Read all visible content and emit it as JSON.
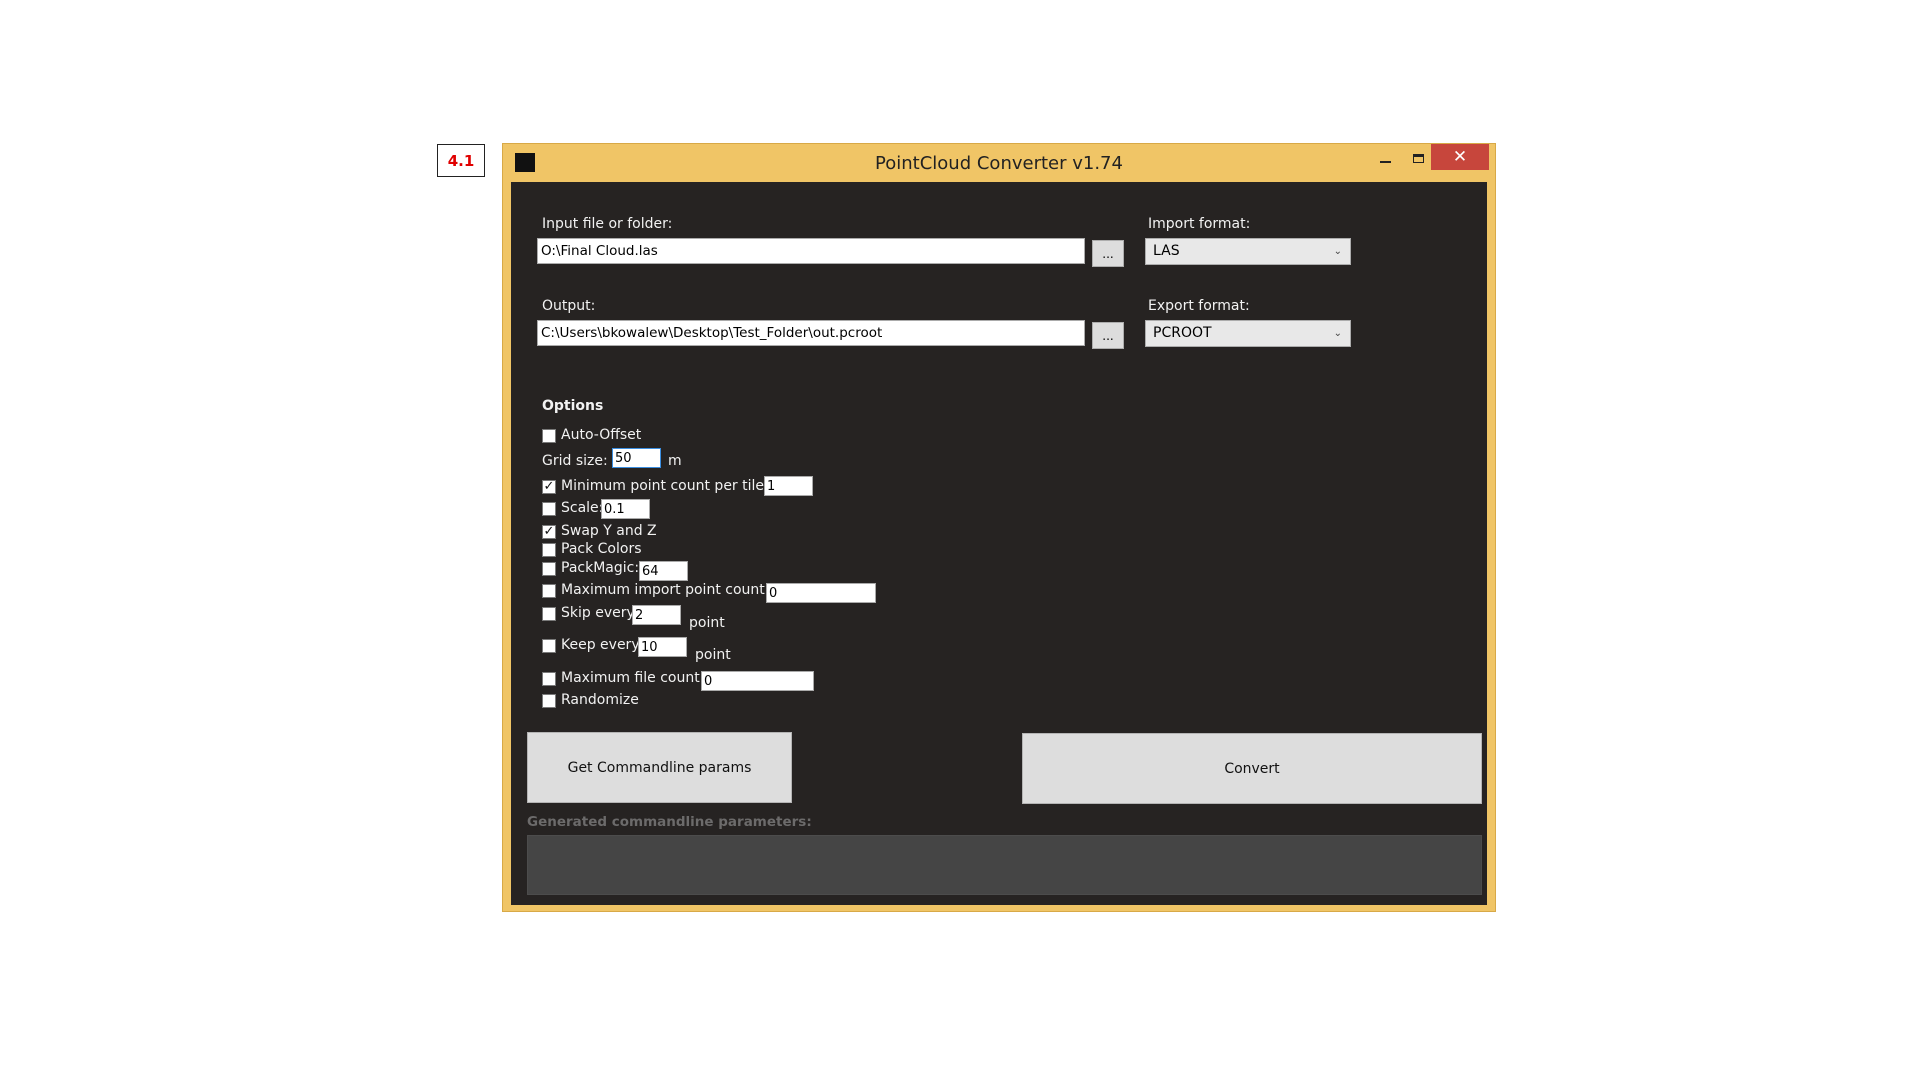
{
  "step_label": "4.1",
  "window": {
    "title": "PointCloud Converter v1.74",
    "minimize_icon": "minimize-icon",
    "maximize_icon": "maximize-icon",
    "close_symbol": "✕"
  },
  "input": {
    "label": "Input file or folder:",
    "value": "O:\\Final Cloud.las",
    "browse_label": "..."
  },
  "output": {
    "label": "Output:",
    "value": "C:\\Users\\bkowalew\\Desktop\\Test_Folder\\out.pcroot",
    "browse_label": "..."
  },
  "import_format": {
    "label": "Import format:",
    "selected": "LAS"
  },
  "export_format": {
    "label": "Export format:",
    "selected": "PCROOT"
  },
  "options": {
    "title": "Options",
    "auto_offset": {
      "label": "Auto-Offset",
      "checked": false
    },
    "grid_size": {
      "label": "Grid size:",
      "value": "50",
      "unit": "m"
    },
    "min_point_count": {
      "label": "Minimum point count per tile:",
      "checked": true,
      "value": "1"
    },
    "scale": {
      "label": "Scale:",
      "checked": false,
      "value": "0.1"
    },
    "swap_yz": {
      "label": "Swap Y and Z",
      "checked": true
    },
    "pack_colors": {
      "label": "Pack Colors",
      "checked": false
    },
    "pack_magic": {
      "label": "PackMagic:",
      "checked": false,
      "value": "64"
    },
    "max_import_point_count": {
      "label": "Maximum import point count:",
      "checked": false,
      "value": "0"
    },
    "skip_every": {
      "label": "Skip every:",
      "checked": false,
      "value": "2",
      "unit": "point"
    },
    "keep_every": {
      "label": "Keep every:",
      "checked": false,
      "value": "10",
      "unit": "point"
    },
    "max_file_count": {
      "label": "Maximum file count:",
      "checked": false,
      "value": "0"
    },
    "randomize": {
      "label": "Randomize",
      "checked": false
    }
  },
  "buttons": {
    "get_params": "Get Commandline params",
    "convert": "Convert"
  },
  "generated": {
    "label": "Generated commandline parameters:",
    "value": ""
  },
  "colors": {
    "window_frame": "#f0c566",
    "client_bg": "#262322",
    "close_button": "#c7463c",
    "step_label_text": "#e00000"
  }
}
